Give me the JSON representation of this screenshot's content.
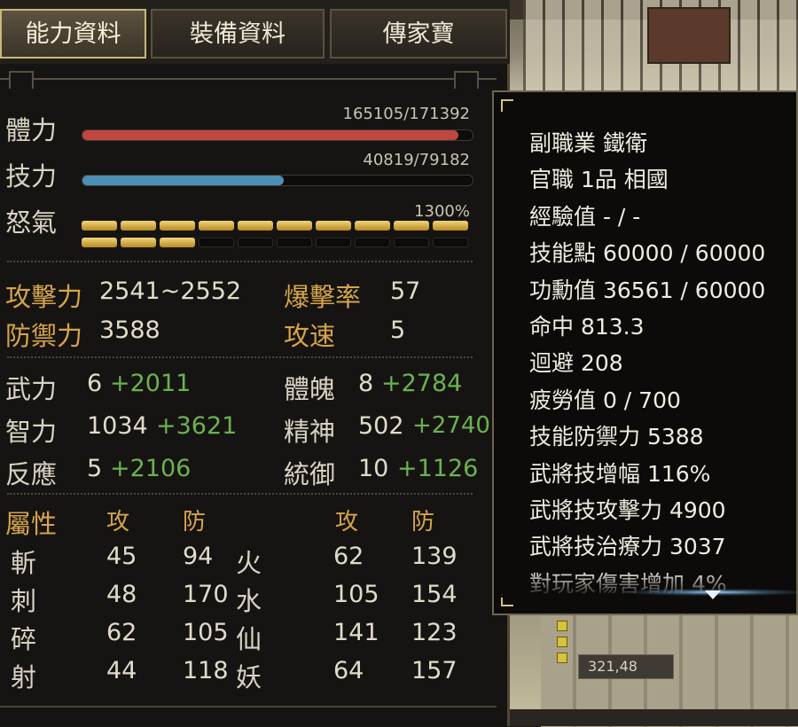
{
  "tabs": [
    "能力資料",
    "裝備資料",
    "傳家寶"
  ],
  "bars": {
    "hp": {
      "label": "體力",
      "text": "165105/171392",
      "fraction": 0.963,
      "color": "#c0473f"
    },
    "mp": {
      "label": "技力",
      "text": "40819/79182",
      "fraction": 0.515,
      "color": "#4c8fb3"
    },
    "rage": {
      "label": "怒氣",
      "text": "1300%",
      "segments_total": 20,
      "segments_filled": 13
    }
  },
  "combat": {
    "attack_label": "攻擊力",
    "attack_value": "2541~2552",
    "crit_label": "爆擊率",
    "crit_value": "57",
    "defense_label": "防禦力",
    "defense_value": "3588",
    "speed_label": "攻速",
    "speed_value": "5"
  },
  "attributes": {
    "wu_label": "武力",
    "wu_base": "6",
    "wu_bonus": "+2011",
    "tipo_label": "體魄",
    "tipo_base": "8",
    "tipo_bonus": "+2784",
    "zhi_label": "智力",
    "zhi_base": "1034",
    "zhi_bonus": "+3621",
    "jing_label": "精神",
    "jing_base": "502",
    "jing_bonus": "+2740",
    "fan_label": "反應",
    "fan_base": "5",
    "fan_bonus": "+2106",
    "tong_label": "統御",
    "tong_base": "10",
    "tong_bonus": "+1126"
  },
  "elements": {
    "header": {
      "label": "屬性",
      "atk": "攻",
      "def": "防",
      "atk2": "攻",
      "def2": "防"
    },
    "rows": [
      {
        "name": "斬",
        "atk": "45",
        "def": "94",
        "name2": "火",
        "atk2": "62",
        "def2": "139"
      },
      {
        "name": "刺",
        "atk": "48",
        "def": "170",
        "name2": "水",
        "atk2": "105",
        "def2": "154"
      },
      {
        "name": "碎",
        "atk": "62",
        "def": "105",
        "name2": "仙",
        "atk2": "141",
        "def2": "123"
      },
      {
        "name": "射",
        "atk": "44",
        "def": "118",
        "name2": "妖",
        "atk2": "64",
        "def2": "157"
      }
    ]
  },
  "tooltip": {
    "lines": [
      "副職業 鐵衛",
      "官職 1品 相國",
      "經驗值 - / -",
      "技能點 60000 / 60000",
      "功勳值 36561 / 60000",
      "命中 813.3",
      "迴避 208",
      "疲勞值 0 / 700",
      "技能防禦力 5388",
      "武將技增幅 116%",
      "武將技攻擊力 4900",
      "武將技治療力 3037",
      "對玩家傷害增加 4%"
    ]
  },
  "map": {
    "coord": "321,48"
  }
}
